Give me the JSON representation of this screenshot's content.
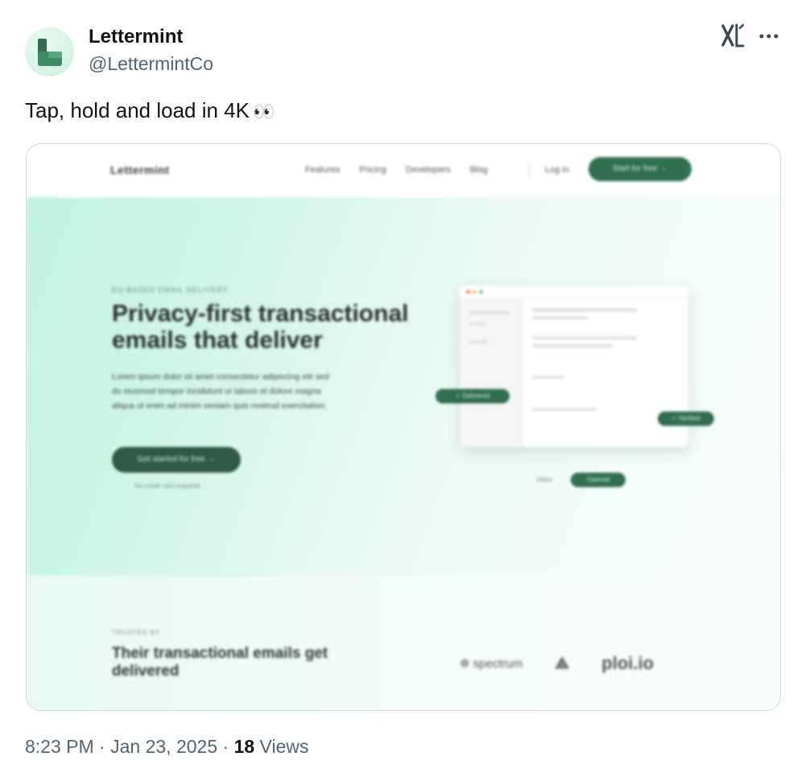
{
  "author": {
    "display_name": "Lettermint",
    "handle": "@LettermintCo",
    "avatar_icon": "lettermint-logo-icon"
  },
  "post": {
    "text": "Tap, hold and load in 4K",
    "emoji": "👀"
  },
  "media": {
    "site_nav": {
      "logo": "Lettermint",
      "links": [
        "Features",
        "Pricing",
        "Developers",
        "Blog"
      ],
      "login": "Log in",
      "cta": "Start for free →"
    },
    "hero": {
      "eyebrow": "EU-BASED EMAIL DELIVERY",
      "title": "Privacy-first transactional emails that deliver",
      "description": "Lorem ipsum dolor sit amet consectetur adipiscing elit sed do eiusmod tempor incididunt ut labore et dolore magna aliqua ut enim ad minim veniam quis nostrud exercitation.",
      "cta": "Get started for free →",
      "sub_note": "No credit card required",
      "floating_labels": [
        "✓ Delivered",
        "✓ Verified",
        "Inbox",
        "Opened"
      ]
    },
    "trusted": {
      "eyebrow": "TRUSTED BY",
      "title": "Their transactional emails get delivered",
      "logos": [
        "✲ spectrum",
        "⟁",
        "ploi.io"
      ]
    }
  },
  "meta": {
    "time": "8:23 PM",
    "separator": " · ",
    "date": "Jan 23, 2025",
    "views_count": "18",
    "views_label": " Views"
  },
  "colors": {
    "brand_green": "#2f6e4e",
    "text_primary": "#0f1419",
    "text_secondary": "#536471"
  }
}
